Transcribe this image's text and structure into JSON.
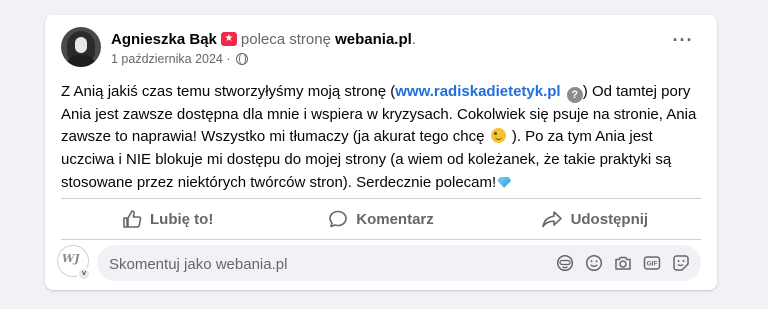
{
  "post": {
    "author": "Agnieszka Bąk",
    "recommends_text": "poleca stronę",
    "page_name": "webania.pl",
    "page_trail": ".",
    "date": "1 października 2024",
    "date_sep": " · ",
    "more_label": "···",
    "text_part1": "Z Anią jakiś czas temu stworzyłyśmy moją stronę (",
    "link_text": "www.radiskadietetyk.pl",
    "text_part2": ") Od tamtej pory Ania jest zawsze dostępna dla mnie i wspiera w kryzysach. Cokolwiek się psuje na stronie, Ania zawsze to naprawia! Wszystko mi tłumaczy (ja akurat tego chcę ",
    "text_part3": " ). Po za tym Ania jest uczciwa i NIE blokuje mi dostępu do mojej strony (a wiem od koleżanek, że takie praktyki są stosowane przez niektórych twórców stron). Serdecznie polecam!",
    "link_info_icon": "?"
  },
  "actions": {
    "like_label": "Lubię to!",
    "comment_label": "Komentarz",
    "share_label": "Udostępnij"
  },
  "comment": {
    "placeholder": "Skomentuj jako webania.pl",
    "avatar_chevron": "˅"
  },
  "icons": {
    "recommend": "recommend-badge-icon",
    "privacy": "globe-icon",
    "like": "thumbs-up-icon",
    "comment": "speech-bubble-icon",
    "share": "share-arrow-icon",
    "tools": [
      "avatar-sticker-icon",
      "emoji-icon",
      "camera-icon",
      "gif-icon",
      "sticker-icon"
    ]
  },
  "colors": {
    "link": "#216fdb",
    "recommend_badge": "#f02849",
    "secondary_text": "#65676b",
    "background": "#f0f2f5"
  }
}
